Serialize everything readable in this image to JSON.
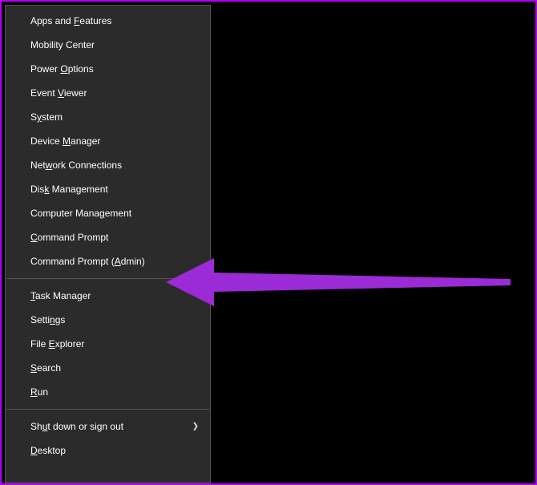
{
  "menu": {
    "items": [
      {
        "pre": "Apps and ",
        "u": "F",
        "post": "eatures"
      },
      {
        "pre": "Mobility Center",
        "u": "",
        "post": ""
      },
      {
        "pre": "Power ",
        "u": "O",
        "post": "ptions"
      },
      {
        "pre": "Event ",
        "u": "V",
        "post": "iewer"
      },
      {
        "pre": "S",
        "u": "y",
        "post": "stem"
      },
      {
        "pre": "Device ",
        "u": "M",
        "post": "anager"
      },
      {
        "pre": "Net",
        "u": "w",
        "post": "ork Connections"
      },
      {
        "pre": "Dis",
        "u": "k",
        "post": " Management"
      },
      {
        "pre": "Computer Mana",
        "u": "g",
        "post": "ement"
      },
      {
        "pre": "",
        "u": "C",
        "post": "ommand Prompt"
      },
      {
        "pre": "Command Prompt (",
        "u": "A",
        "post": "dmin)"
      }
    ],
    "group2": [
      {
        "pre": "",
        "u": "T",
        "post": "ask Manager"
      },
      {
        "pre": "Setti",
        "u": "n",
        "post": "gs"
      },
      {
        "pre": "File ",
        "u": "E",
        "post": "xplorer"
      },
      {
        "pre": "",
        "u": "S",
        "post": "earch"
      },
      {
        "pre": "",
        "u": "R",
        "post": "un"
      }
    ],
    "group3": [
      {
        "pre": "Sh",
        "u": "u",
        "post": "t down or sign out",
        "has_submenu": true
      },
      {
        "pre": "",
        "u": "D",
        "post": "esktop"
      }
    ]
  },
  "colors": {
    "accent_border": "#b100ff",
    "menu_bg": "#2b2b2b",
    "arrow_fill": "#9a2bd6"
  }
}
